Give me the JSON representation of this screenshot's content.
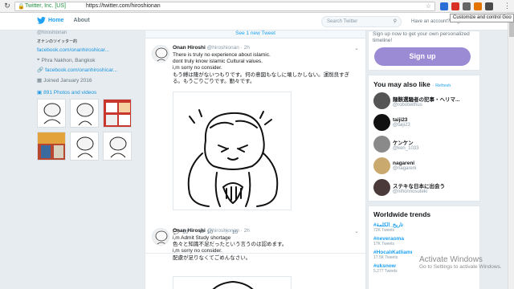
{
  "browser": {
    "cert": "Twitter, Inc. [US]",
    "url": "https://twitter.com/hiroshionan",
    "tooltip": "Customize and control Goo"
  },
  "topbar": {
    "home": "Home",
    "about": "About",
    "search_placeholder": "Search Twitter",
    "have_account": "Have an account? Log in"
  },
  "profile": {
    "handle": "@hiroshionan",
    "bio": "オナンのツイッター的",
    "link1": "facebook.com/onanhiroshicar...",
    "location": "Phra Nakhon, Bangkok",
    "link2": "facebook.com/onanhiroshicar...",
    "joined": "Joined January 2016",
    "photos": "891 Photos and videos"
  },
  "timeline": {
    "new_tweet": "See 1 new Tweet",
    "tweets": [
      {
        "name": "Onan Hiroshi",
        "handle": "@hiroshionan",
        "time": "· 2h",
        "lines": [
          "There is truly no experience about islamic.",
          "dont truly know islamic Cultural values.",
          "i,m sorry no consider.",
          "もう縛は隆がないつもりです。何の意図もなしに壊しかしない。運削良すぎ",
          "る。もうごりごりです。勤々です。"
        ],
        "replies": "10",
        "retweets": "10",
        "likes": "10"
      },
      {
        "name": "Onan Hiroshi",
        "handle": "@hiroshionan",
        "time": "· 2h",
        "lines": [
          "i,m Admit Study shortage",
          "色々と知識不足だったという言うのは認めます。",
          "i,m sorry no consider.",
          "配慮が足りなくてごめんなさい。"
        ]
      }
    ]
  },
  "sidebar": {
    "cta": "Sign up now to get your own personalized timeline!",
    "signup": "Sign up",
    "wtf_title": "You may also like",
    "refresh": "· Refresh",
    "suggestions": [
      {
        "name": "麺骸選騒者の犯事・ヘリマ...",
        "handle": "@robotwithus"
      },
      {
        "name": "taiji23",
        "handle": "@taiji23"
      },
      {
        "name": "ケンケン",
        "handle": "@ken_1033"
      },
      {
        "name": "nagareni",
        "handle": "@nagareni"
      },
      {
        "name": "ステキな日本に出会う",
        "handle": "@nihonnosuteki"
      }
    ],
    "trends_title": "Worldwide trends",
    "trends": [
      {
        "tag": "#تاريخ_الكلمة",
        "count": "72K Tweets"
      },
      {
        "tag": "#neveraoma",
        "count": "17K Tweets"
      },
      {
        "tag": "#HocalıKatliamı",
        "count": "17.5K Tweets"
      },
      {
        "tag": "#uksnow",
        "count": "5,277 Tweets"
      }
    ]
  },
  "watermark": {
    "title": "Activate Windows",
    "sub": "Go to Settings to activate Windows."
  }
}
